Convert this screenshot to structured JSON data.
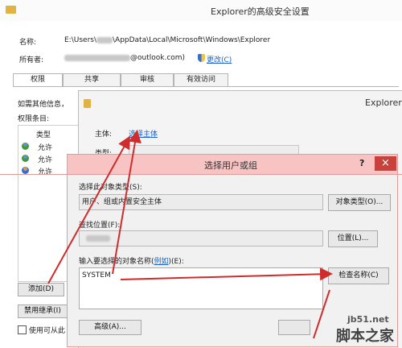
{
  "main_window": {
    "title": "Explorer的高级安全设置",
    "name_label": "名称:",
    "name_prefix": "E:\\Users\\",
    "name_suffix": "\\AppData\\Local\\Microsoft\\Windows\\Explorer",
    "owner_label": "所有者:",
    "owner_suffix": "@outlook.com)",
    "change_link": "更改(C)",
    "tabs": [
      "权限",
      "共享",
      "审核",
      "有效访问"
    ],
    "info_text": "如需其他信息，",
    "perm_entries_label": "权限条目:",
    "col_type": "类型",
    "rows": [
      "允许",
      "允许",
      "允许"
    ],
    "add_button": "添加(D)",
    "disable_inherit_button": "禁用继承(I)",
    "use_checkbox_label": "使用可从此"
  },
  "sub_window": {
    "title": "Explorer",
    "principal_label": "主体:",
    "select_principal_link": "选择主体",
    "type_label": "类型:"
  },
  "dialog": {
    "title": "选择用户或组",
    "help_glyph": "?",
    "close_glyph": "×",
    "object_type_label": "选择此对象类型(S):",
    "object_type_value": "用户、组或内置安全主体",
    "object_types_button": "对象类型(O)...",
    "location_label": "查找位置(F):",
    "locations_button": "位置(L)...",
    "enter_names_label_a": "输入要选择的对象名称(",
    "enter_names_link": "例如",
    "enter_names_label_b": ")(E):",
    "name_input_value": "SYSTEM",
    "check_names_button": "检查名称(C)",
    "advanced_button": "高级(A)..."
  },
  "watermark": {
    "site": "jb51.net",
    "brand": "脚本之家"
  }
}
